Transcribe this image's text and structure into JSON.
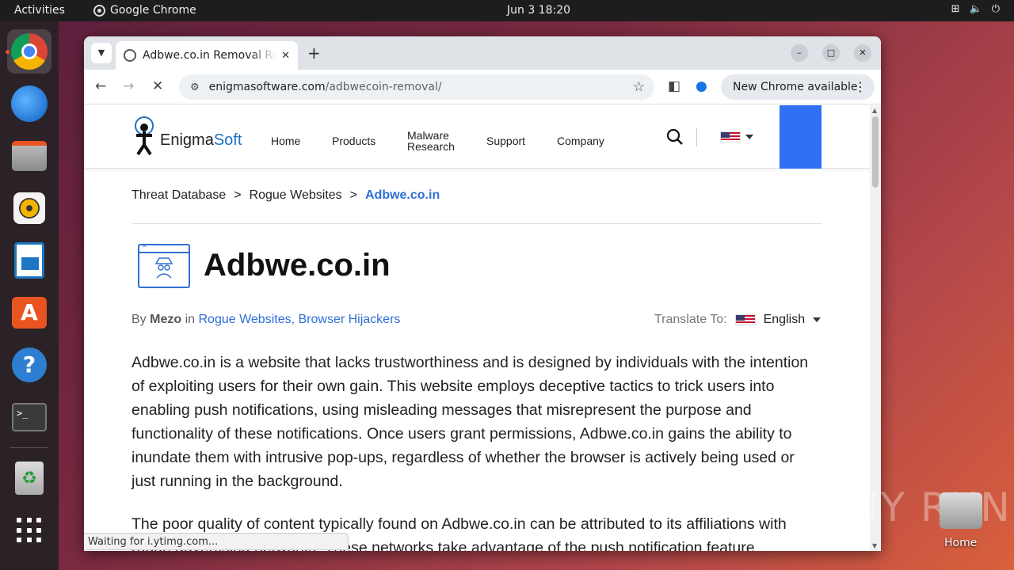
{
  "topbar": {
    "activities": "Activities",
    "app_name": "Google Chrome",
    "clock": "Jun 3  18:20"
  },
  "dock": {
    "items": [
      "chrome",
      "thunderbird",
      "files",
      "rhythmbox",
      "libreoffice-writer",
      "app-center",
      "help",
      "terminal",
      "trash",
      "show-apps"
    ]
  },
  "browser": {
    "tab_title": "Adbwe.co.in Removal Re",
    "url_domain": "enigmasoftware.com",
    "url_path": "/adbwecoin-removal/",
    "update_label": "New Chrome available",
    "status_text": "Waiting for i.ytimg.com..."
  },
  "site": {
    "logo_text_1": "Enigma",
    "logo_text_2": "Soft",
    "nav": {
      "home": "Home",
      "products": "Products",
      "malware_1": "Malware",
      "malware_2": "Research",
      "support": "Support",
      "company": "Company"
    },
    "accent_color": "#2f6ff3"
  },
  "breadcrumb": {
    "item1": "Threat Database",
    "item2": "Rogue Websites",
    "current": "Adbwe.co.in",
    "separator": ">"
  },
  "article": {
    "title": "Adbwe.co.in",
    "by": "By",
    "author": "Mezo",
    "in": "in",
    "cat1": "Rogue Websites,",
    "cat2": "Browser Hijackers",
    "translate_label": "Translate To:",
    "language": "English",
    "para1": "Adbwe.co.in is a website that lacks trustworthiness and is designed by individuals with the intention of exploiting users for their own gain. This website employs deceptive tactics to trick users into enabling push notifications, using misleading messages that misrepresent the purpose and functionality of these notifications. Once users grant permissions, Adbwe.co.in gains the ability to inundate them with intrusive pop-ups, regardless of whether the browser is actively being used or just running in the background.",
    "para2": "The poor quality of content typically found on Adbwe.co.in can be attributed to its affiliations with rogue advertising networks. These networks take advantage of the push notification feature"
  },
  "desktop": {
    "home_label": "Home",
    "watermark": "ANY RUN"
  }
}
